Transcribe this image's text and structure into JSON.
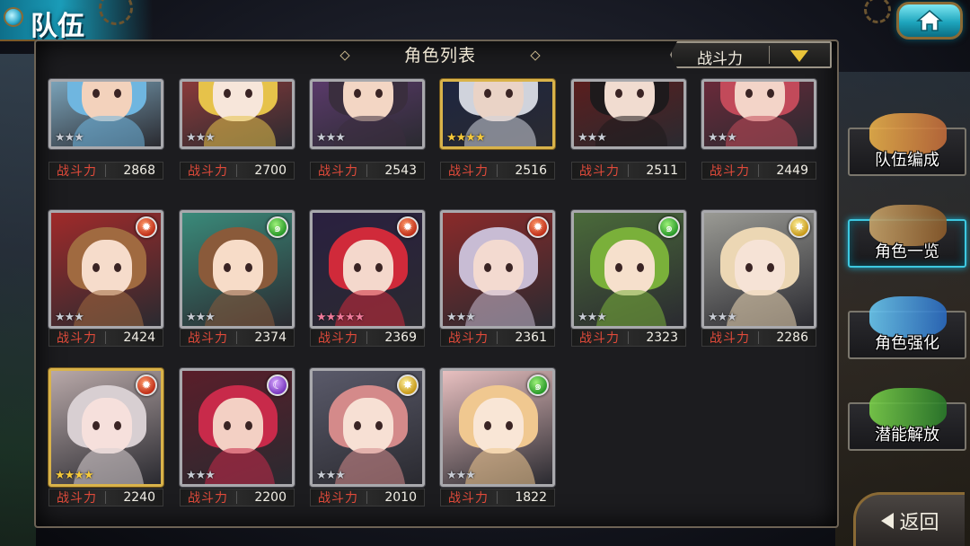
{
  "screen": {
    "title": "队伍"
  },
  "panel": {
    "title": "角色列表",
    "sort": {
      "label": "战斗力"
    }
  },
  "power_label": "战斗力",
  "characters": [
    {
      "power": "2868",
      "stars": 3,
      "star_style": "silver",
      "element": null,
      "hair": "#6fb6e0",
      "skin": "#f3d2bc",
      "bg": "#7aa2b8",
      "frame": "silver"
    },
    {
      "power": "2700",
      "stars": 3,
      "star_style": "silver",
      "element": null,
      "hair": "#e6c24a",
      "skin": "#f7e6da",
      "bg": "#8a3a3a",
      "frame": "silver"
    },
    {
      "power": "2543",
      "stars": 3,
      "star_style": "silver",
      "element": null,
      "hair": "#3a2e3e",
      "skin": "#f3d6c4",
      "bg": "#5a3a6a",
      "frame": "silver"
    },
    {
      "power": "2516",
      "stars": 4,
      "star_style": "gold",
      "element": null,
      "hair": "#d0d3dc",
      "skin": "#ead3c6",
      "bg": "#1e2640",
      "frame": "gold"
    },
    {
      "power": "2511",
      "stars": 3,
      "star_style": "silver",
      "element": null,
      "hair": "#1e1a1c",
      "skin": "#f1dcd0",
      "bg": "#5a1e1e",
      "frame": "silver"
    },
    {
      "power": "2449",
      "stars": 3,
      "star_style": "silver",
      "element": null,
      "hair": "#c24a5a",
      "skin": "#f3d4c8",
      "bg": "#6a2a3a",
      "frame": "silver"
    },
    {
      "power": "2424",
      "stars": 3,
      "star_style": "silver",
      "element": "fire",
      "hair": "#a06a40",
      "skin": "#f6dccb",
      "bg": "#a02a2a",
      "frame": "silver"
    },
    {
      "power": "2374",
      "stars": 3,
      "star_style": "silver",
      "element": "wind",
      "hair": "#8a5a3a",
      "skin": "#f7dcc8",
      "bg": "#3a8a7a",
      "frame": "silver"
    },
    {
      "power": "2369",
      "stars": 5,
      "star_style": "colorful",
      "element": "fire",
      "hair": "#d02a3a",
      "skin": "#f4d8cc",
      "bg": "#2a2040",
      "frame": "silver"
    },
    {
      "power": "2361",
      "stars": 3,
      "star_style": "silver",
      "element": "fire",
      "hair": "#c8bcd4",
      "skin": "#f3dad0",
      "bg": "#8a2a2a",
      "frame": "silver"
    },
    {
      "power": "2323",
      "stars": 3,
      "star_style": "silver",
      "element": "wind",
      "hair": "#7ab03a",
      "skin": "#f6e0cc",
      "bg": "#4a6a3a",
      "frame": "silver"
    },
    {
      "power": "2286",
      "stars": 3,
      "star_style": "silver",
      "element": "light",
      "hair": "#ecd7b4",
      "skin": "#f6e3d6",
      "bg": "#9a9a94",
      "frame": "silver"
    },
    {
      "power": "2240",
      "stars": 4,
      "star_style": "gold",
      "element": "fire",
      "hair": "#d8cfd2",
      "skin": "#f6e0dc",
      "bg": "#b8a8a8",
      "frame": "gold"
    },
    {
      "power": "2200",
      "stars": 3,
      "star_style": "silver",
      "element": "dark",
      "hair": "#c82a4a",
      "skin": "#f3d0c4",
      "bg": "#5a1e2a",
      "frame": "silver"
    },
    {
      "power": "2010",
      "stars": 3,
      "star_style": "silver",
      "element": "light",
      "hair": "#d48a8a",
      "skin": "#f7e0d4",
      "bg": "#5a5a6a",
      "frame": "silver"
    },
    {
      "power": "1822",
      "stars": 3,
      "star_style": "silver",
      "element": "wind",
      "hair": "#f0c890",
      "skin": "#f9e6d6",
      "bg": "#e8c0c0",
      "frame": "silver"
    }
  ],
  "side_menu": [
    {
      "label": "队伍编成",
      "icon": "party-members-icon",
      "active": false
    },
    {
      "label": "角色一览",
      "icon": "character-book-icon",
      "active": true
    },
    {
      "label": "角色强化",
      "icon": "enhance-crystal-icon",
      "active": false
    },
    {
      "label": "潜能解放",
      "icon": "potential-orb-icon",
      "active": false
    }
  ],
  "back": {
    "label": "返回"
  },
  "colors": {
    "accent": "#1aa8c8",
    "power_label": "#e04a3a",
    "gold": "#d9b34a"
  }
}
